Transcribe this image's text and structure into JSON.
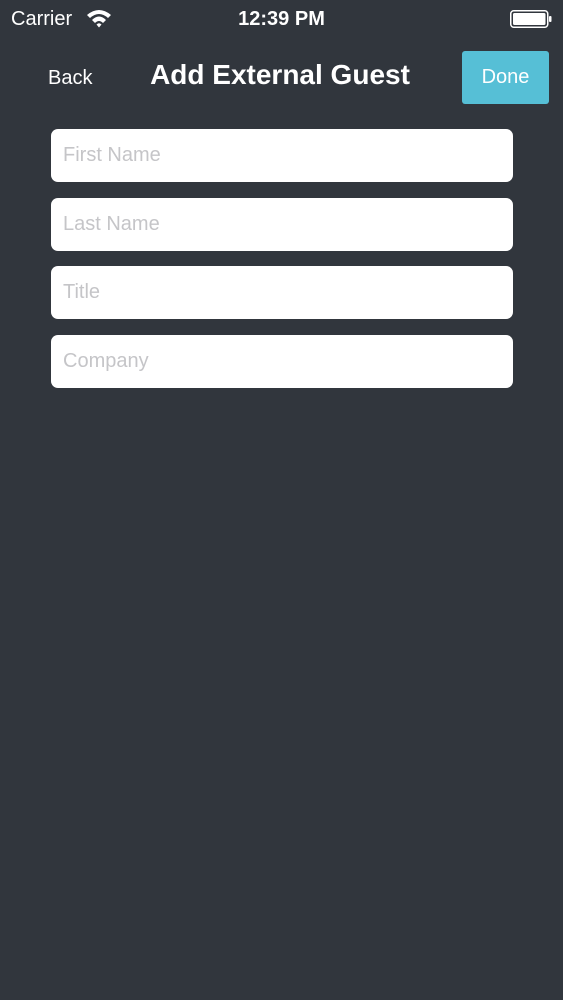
{
  "status_bar": {
    "carrier": "Carrier",
    "time": "12:39 PM",
    "wifi_icon": "wifi-icon",
    "battery_icon": "battery-icon"
  },
  "nav": {
    "back_label": "Back",
    "title": "Add External Guest",
    "done_label": "Done"
  },
  "form": {
    "fields": [
      {
        "placeholder": "First Name",
        "value": ""
      },
      {
        "placeholder": "Last Name",
        "value": ""
      },
      {
        "placeholder": "Title",
        "value": ""
      },
      {
        "placeholder": "Company",
        "value": ""
      }
    ]
  },
  "colors": {
    "background": "#31363d",
    "accent": "#56bfd6",
    "field_background": "#ffffff",
    "placeholder": "#c5c5c8",
    "text": "#ffffff"
  }
}
